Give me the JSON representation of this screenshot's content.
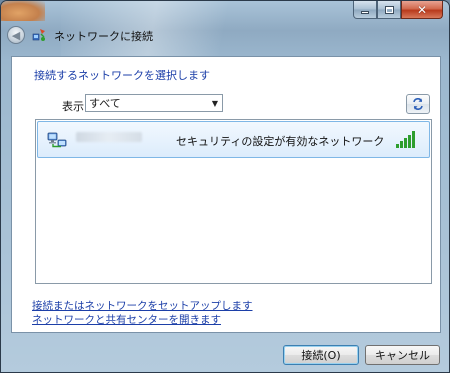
{
  "window": {
    "title": "ネットワークに接続",
    "caption_buttons": [
      "minimize",
      "maximize",
      "close"
    ]
  },
  "main": {
    "heading": "接続するネットワークを選択します",
    "filter": {
      "label": "表示",
      "selected": "すべて"
    },
    "networks": [
      {
        "name": "",
        "description": "セキュリティの設定が有効なネットワーク",
        "signal_bars": 5,
        "icon": "network-computer-icon"
      }
    ]
  },
  "links": {
    "setup": "接続またはネットワークをセットアップします",
    "center": "ネットワークと共有センターを開きます"
  },
  "buttons": {
    "connect": "接続(O)",
    "cancel": "キャンセル"
  },
  "colors": {
    "link": "#1c3fa8",
    "selection": "#dcecfc",
    "signal": "#2e9e2e"
  }
}
